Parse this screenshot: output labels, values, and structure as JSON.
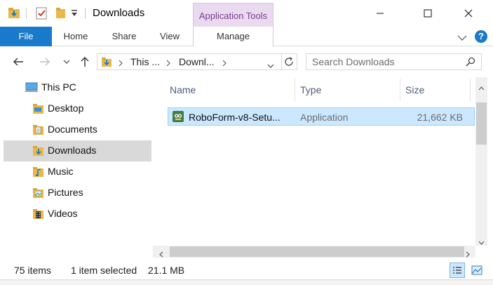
{
  "window": {
    "title": "Downloads",
    "context_tab": "Application Tools",
    "controls": {
      "minimize": "–",
      "maximize": "☐",
      "close": "✕"
    }
  },
  "ribbon": {
    "tabs": [
      "File",
      "Home",
      "Share",
      "View",
      "Manage"
    ],
    "help": "?"
  },
  "navigation": {
    "breadcrumb": [
      "This ...",
      "Downl..."
    ],
    "search_placeholder": "Search Downloads"
  },
  "sidebar": {
    "items": [
      {
        "label": "This PC",
        "icon": "computer-icon"
      },
      {
        "label": "Desktop",
        "icon": "desktop-folder-icon"
      },
      {
        "label": "Documents",
        "icon": "documents-folder-icon"
      },
      {
        "label": "Downloads",
        "icon": "downloads-folder-icon",
        "selected": true
      },
      {
        "label": "Music",
        "icon": "music-folder-icon"
      },
      {
        "label": "Pictures",
        "icon": "pictures-folder-icon"
      },
      {
        "label": "Videos",
        "icon": "videos-folder-icon"
      }
    ]
  },
  "file_list": {
    "columns": [
      "Name",
      "Type",
      "Size"
    ],
    "rows": [
      {
        "name": "RoboForm-v8-Setu...",
        "type": "Application",
        "size": "21,662 KB",
        "selected": true,
        "icon": "roboform-app-icon"
      }
    ]
  },
  "status": {
    "item_count": "75 items",
    "selection": "1 item selected",
    "selection_size": "21.1 MB"
  },
  "colors": {
    "accent": "#1979ca",
    "context_tab": "#eadaf0",
    "selection": "#cce8ff",
    "selection_border": "#99d1ff",
    "sidebar_selected": "#d9d9d9"
  }
}
